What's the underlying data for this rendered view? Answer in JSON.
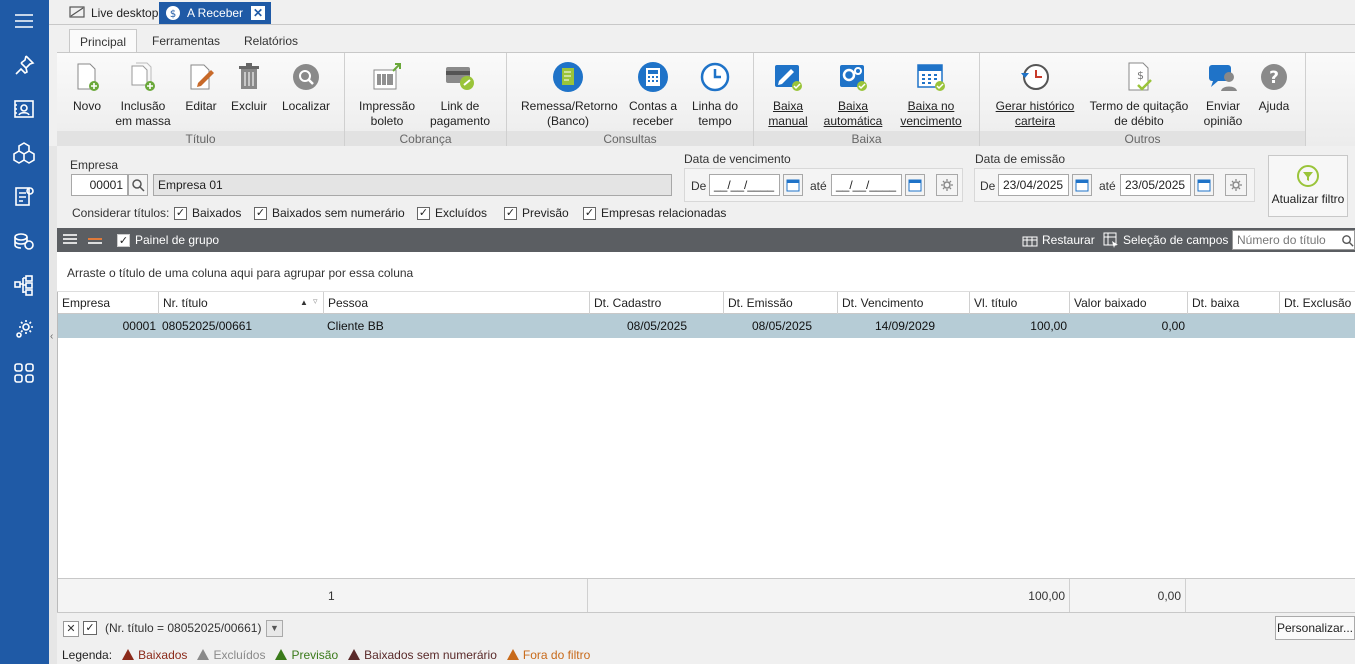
{
  "colors": {
    "sidebar": "#1f5aa6",
    "accent": "#1f5aa6",
    "row_selected": "#b6ccd6",
    "toolbar": "#5b5e62"
  },
  "sidebar": {
    "icons": [
      "menu-icon",
      "pin-icon",
      "contacts-icon",
      "cubes-icon",
      "invoice-icon",
      "coins-icon",
      "hierarchy-icon",
      "settings-icon",
      "apps-icon"
    ]
  },
  "doc_tabs": {
    "live": "Live desktop",
    "active": "A Receber",
    "close": "✕"
  },
  "ribbon_tabs": [
    "Principal",
    "Ferramentas",
    "Relatórios"
  ],
  "ribbon": {
    "titulo": {
      "label": "Título",
      "buttons": [
        "Novo",
        "Inclusão\nem massa",
        "Editar",
        "Excluir",
        "Localizar"
      ]
    },
    "cobranca": {
      "label": "Cobrança",
      "buttons": [
        "Impressão\nboleto",
        "Link de\npagamento"
      ]
    },
    "consultas": {
      "label": "Consultas",
      "buttons": [
        "Remessa/Retorno\n(Banco)",
        "Contas a\nreceber",
        "Linha do\ntempo"
      ]
    },
    "baixa": {
      "label": "Baixa",
      "buttons": [
        "Baixa\nmanual",
        "Baixa\nautomática",
        "Baixa no\nvencimento"
      ]
    },
    "outros": {
      "label": "Outros",
      "buttons": [
        "Gerar histórico\ncarteira",
        "Termo de quitação\nde débito",
        "Enviar\nopinião",
        "Ajuda"
      ]
    }
  },
  "filters": {
    "empresa_label": "Empresa",
    "empresa_code": "00001",
    "empresa_name": "Empresa 01",
    "venc_label": "Data de vencimento",
    "venc_de": "De",
    "venc_from": "__/__/____",
    "venc_ate": "até",
    "venc_to": "__/__/____",
    "emis_label": "Data de emissão",
    "emis_de": "De",
    "emis_from": "23/04/2025",
    "emis_ate": "até",
    "emis_to": "23/05/2025",
    "considerar": "Considerar títulos:",
    "checks": [
      "Baixados",
      "Baixados sem numerário",
      "Excluídos",
      "Previsão",
      "Empresas relacionadas"
    ],
    "refresh": "Atualizar filtro"
  },
  "grid_toolbar": {
    "painel": "Painel de grupo",
    "restaurar": "Restaurar",
    "selecao": "Seleção de campos",
    "search_placeholder": "Número do título"
  },
  "group_hint": "Arraste o título de uma coluna aqui para agrupar por essa coluna",
  "columns": [
    "Empresa",
    "Nr. título",
    "Pessoa",
    "Dt. Cadastro",
    "Dt. Emissão",
    "Dt. Vencimento",
    "Vl. título",
    "Valor baixado",
    "Dt. baixa",
    "Dt. Exclusão"
  ],
  "rows": [
    {
      "empresa": "00001",
      "nr": "08052025/00661",
      "pessoa": "Cliente BB",
      "cadastro": "08/05/2025",
      "emissao": "08/05/2025",
      "vencimento": "14/09/2029",
      "valor": "100,00",
      "baixado": "0,00",
      "dt_baixa": "",
      "dt_exclusao": ""
    }
  ],
  "footer": {
    "count": "1",
    "sum_valor": "100,00",
    "sum_baixado": "0,00"
  },
  "filter_bar": {
    "close": "✕",
    "check": "✓",
    "expression": "(Nr. título = 08052025/00661)",
    "dropdown": "▼",
    "personalizar": "Personalizar..."
  },
  "legend": {
    "label": "Legenda:",
    "items": [
      {
        "text": "Baixados",
        "color": "#8b2a1a"
      },
      {
        "text": "Excluídos",
        "color": "#8a8a8a"
      },
      {
        "text": "Previsão",
        "color": "#3a7a1a"
      },
      {
        "text": "Baixados sem numerário",
        "color": "#5a2a2a"
      },
      {
        "text": "Fora do filtro",
        "color": "#c86a1a"
      }
    ]
  }
}
